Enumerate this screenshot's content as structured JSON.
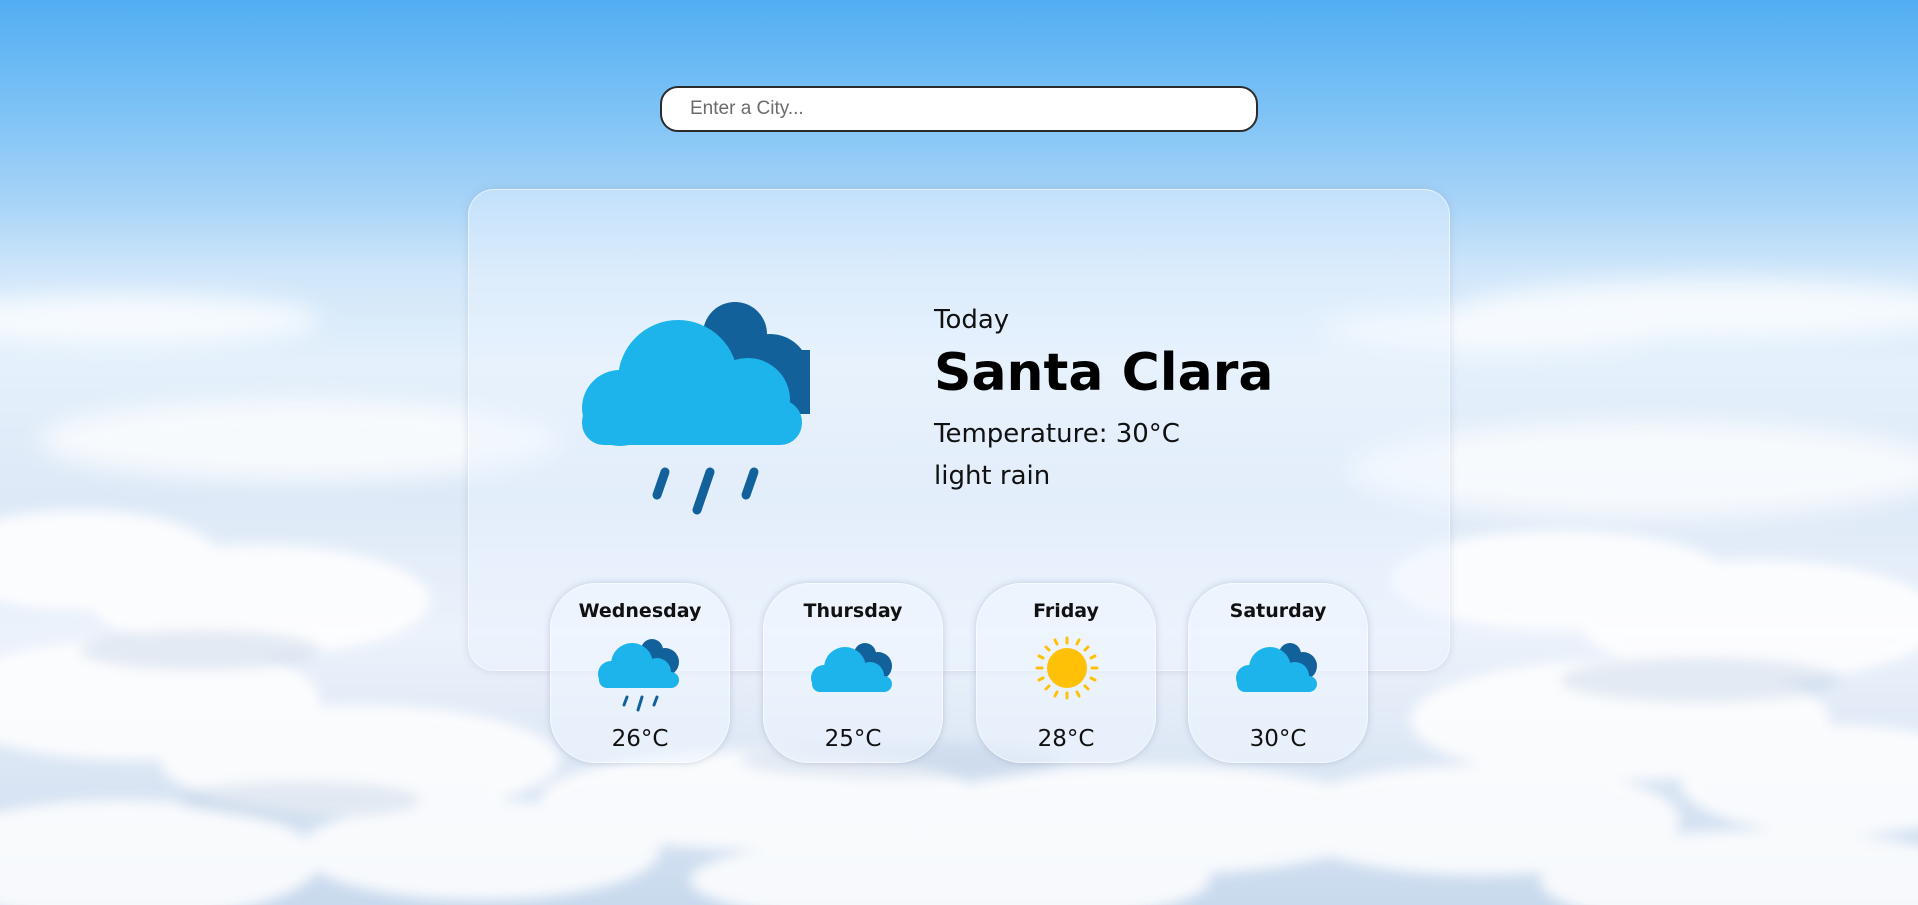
{
  "search": {
    "placeholder": "Enter a City...",
    "value": ""
  },
  "current": {
    "label": "Today",
    "city": "Santa Clara",
    "temperature_text": "Temperature: 30°C",
    "description": "light rain",
    "icon": "rain-cloud-icon"
  },
  "forecast": [
    {
      "day": "Wednesday",
      "temp": "26°C",
      "icon": "rain-cloud-icon"
    },
    {
      "day": "Thursday",
      "temp": "25°C",
      "icon": "cloud-icon"
    },
    {
      "day": "Friday",
      "temp": "28°C",
      "icon": "sun-icon"
    },
    {
      "day": "Saturday",
      "temp": "30°C",
      "icon": "cloud-icon"
    }
  ],
  "colors": {
    "cloud_front": "#1db4ec",
    "cloud_back": "#12619a",
    "rain": "#12619a",
    "sun": "#ffc107"
  }
}
